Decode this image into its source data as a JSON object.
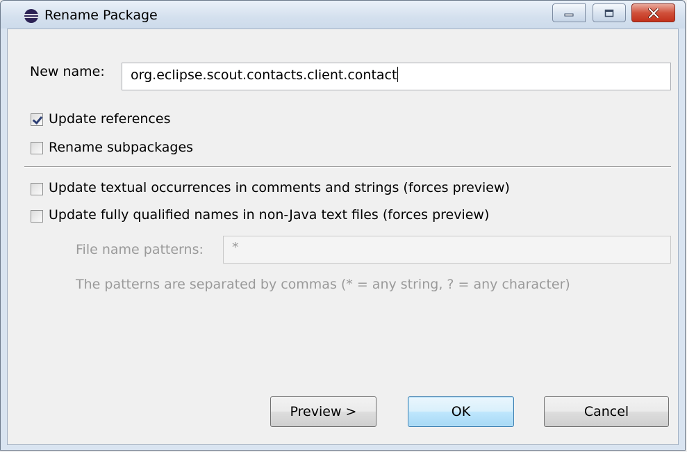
{
  "window": {
    "title": "Rename Package",
    "controls": {
      "minimize": "minimize",
      "maximize": "maximize",
      "close": "close"
    }
  },
  "form": {
    "new_name_label": "New name:",
    "new_name_value": "org.eclipse.scout.contacts.client.contact",
    "update_references": {
      "label": "Update references",
      "checked": true
    },
    "rename_subpackages": {
      "label": "Rename subpackages",
      "checked": false
    },
    "update_textual": {
      "label": "Update textual occurrences in comments and strings (forces preview)",
      "checked": false
    },
    "update_qualified": {
      "label": "Update fully qualified names in non-Java text files (forces preview)",
      "checked": false
    },
    "file_patterns_label": "File name patterns:",
    "file_patterns_value": "*",
    "patterns_hint": "The patterns are separated by commas (* = any string, ? = any character)"
  },
  "buttons": {
    "preview": "Preview >",
    "ok": "OK",
    "cancel": "Cancel"
  },
  "colors": {
    "titlebar": "#d4e0ee",
    "close_button": "#c2301b",
    "default_button_border": "#3c7fb1",
    "disabled_text": "#9a9a9a"
  }
}
